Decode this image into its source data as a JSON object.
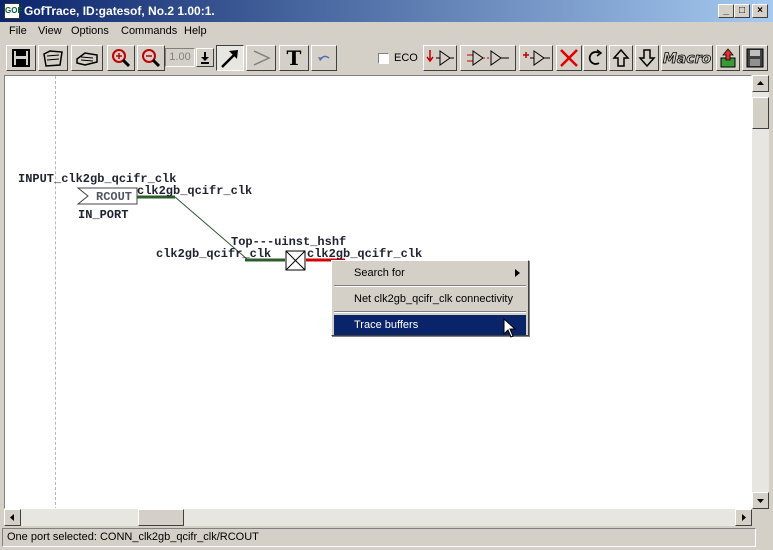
{
  "window": {
    "title": "GofTrace, ID:gatesof, No.2 1.00:1.",
    "icon_text": "GOF",
    "minimize": "_",
    "maximize": "□",
    "close": "×"
  },
  "menu": {
    "items": [
      "File",
      "View",
      "Options",
      "Commands",
      "Help"
    ]
  },
  "toolbar": {
    "zoom_value": "1.00",
    "eco_label": "ECO",
    "eco_checked": false,
    "macro_label": "Macro",
    "text_tool_label": "T",
    "icons": [
      "save-icon",
      "open-icon",
      "print-icon",
      "zoom-in-icon",
      "zoom-out-icon",
      "zoom-dropdown-icon",
      "select-arrow-icon",
      "buffer-icon",
      "text-icon",
      "undo-icon",
      "trace-in-icon",
      "trace-through-icon",
      "trace-out-icon",
      "delete-icon",
      "refresh-icon",
      "up-arrow-icon",
      "down-arrow-icon",
      "macro-icon",
      "export-icon",
      "save-disk-icon"
    ]
  },
  "schematic": {
    "input_label": "INPUT_clk2gb_qcifr_clk",
    "port_pin": "RCOUT",
    "port_label": "IN_PORT",
    "net_label_top": "clk2gb_qcifr_clk",
    "instance_label": "Top---uinst_hshf",
    "net_label_left": "clk2gb_qcifr_clk",
    "net_label_right": "clk2gb_qcifr_clk",
    "colors": {
      "wire": "#2e5b2e",
      "selected_pin": "#d00000",
      "text": "#223322"
    }
  },
  "context_menu": {
    "items": [
      {
        "label": "Search for",
        "submenu": true,
        "selected": false
      },
      {
        "label": "Net clk2gb_qcifr_clk connectivity",
        "submenu": false,
        "selected": false
      },
      {
        "label": "Trace buffers",
        "submenu": false,
        "selected": true
      }
    ],
    "highlight_color": "#0a246a"
  },
  "status": {
    "text": "One port selected: CONN_clk2gb_qcifr_clk/RCOUT"
  }
}
